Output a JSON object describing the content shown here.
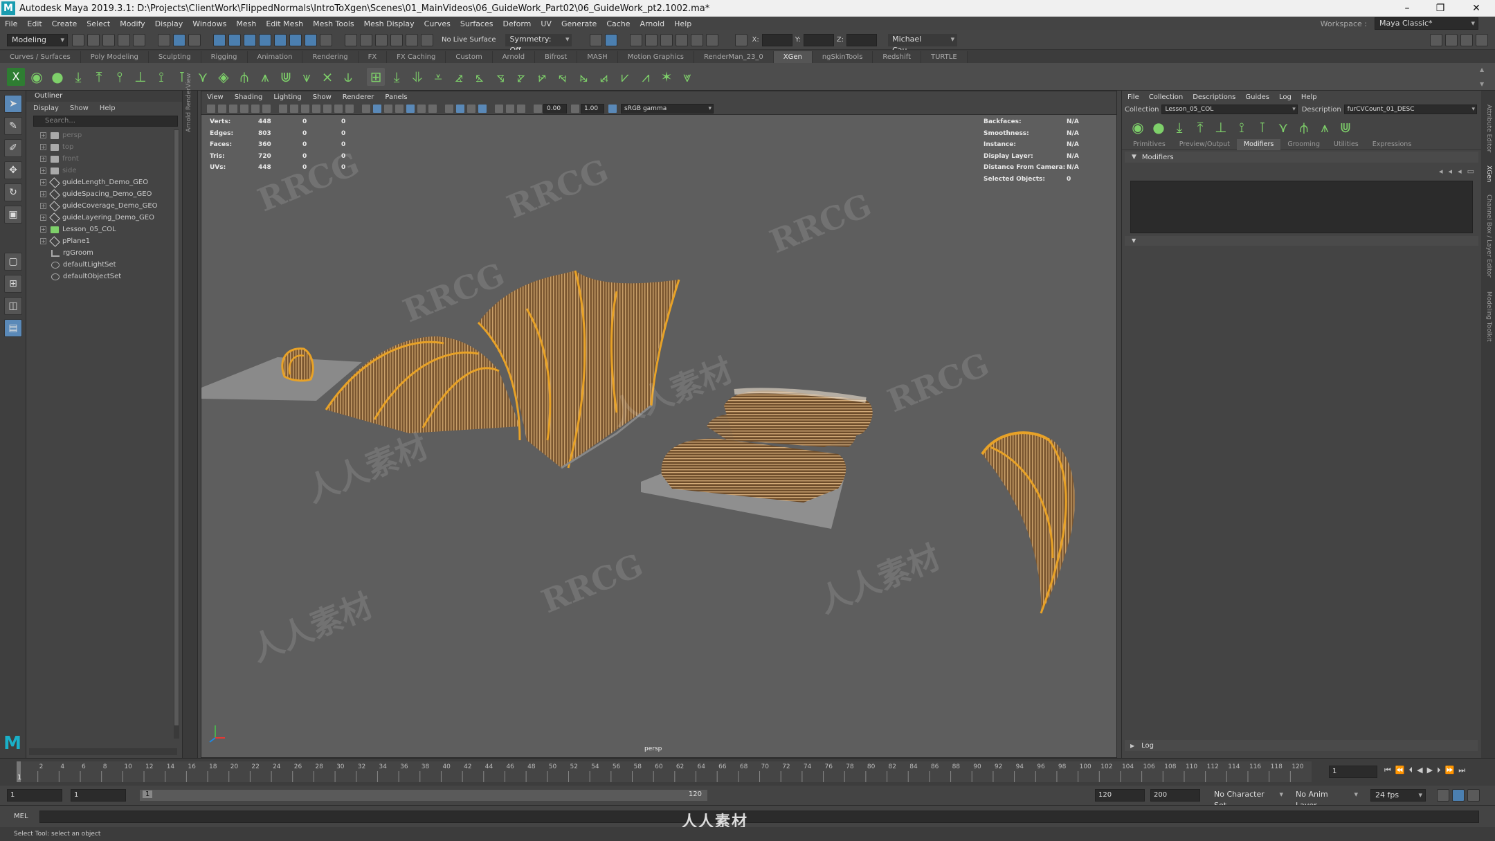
{
  "window": {
    "title": "Autodesk Maya 2019.3.1: D:\\Projects\\ClientWork\\FlippedNormals\\IntroToXgen\\Scenes\\01_MainVideos\\06_GuideWork_Part02\\06_GuideWork_pt2.1002.ma*",
    "minimize": "–",
    "restore": "❐",
    "close": "✕"
  },
  "menubar": [
    "File",
    "Edit",
    "Create",
    "Select",
    "Modify",
    "Display",
    "Windows",
    "Mesh",
    "Edit Mesh",
    "Mesh Tools",
    "Mesh Display",
    "Curves",
    "Surfaces",
    "Deform",
    "UV",
    "Generate",
    "Cache",
    "Arnold",
    "Help"
  ],
  "workspace": {
    "label": "Workspace :",
    "value": "Maya Classic*"
  },
  "status": {
    "mode": "Modeling",
    "live_surface": "No Live Surface",
    "symmetry": "Symmetry: Off",
    "user": "Michael Cau...",
    "x": "X:",
    "y": "Y:",
    "z": "Z:"
  },
  "shelf_tabs": [
    "Curves / Surfaces",
    "Poly Modeling",
    "Sculpting",
    "Rigging",
    "Animation",
    "Rendering",
    "FX",
    "FX Caching",
    "Custom",
    "Arnold",
    "Bifrost",
    "MASH",
    "Motion Graphics",
    "RenderMan_23_0",
    "XGen",
    "ngSkinTools",
    "Redshift",
    "TURTLE"
  ],
  "active_shelf": "XGen",
  "outliner": {
    "title": "Outliner",
    "menu": [
      "Display",
      "Show",
      "Help"
    ],
    "search_placeholder": "Search...",
    "items": [
      {
        "label": "persp",
        "type": "cam",
        "dim": true
      },
      {
        "label": "top",
        "type": "cam",
        "dim": true
      },
      {
        "label": "front",
        "type": "cam",
        "dim": true
      },
      {
        "label": "side",
        "type": "cam",
        "dim": true
      },
      {
        "label": "guideLength_Demo_GEO",
        "type": "mesh",
        "dim": false
      },
      {
        "label": "guideSpacing_Demo_GEO",
        "type": "mesh",
        "dim": false
      },
      {
        "label": "guideCoverage_Demo_GEO",
        "type": "mesh",
        "dim": false
      },
      {
        "label": "guideLayering_Demo_GEO",
        "type": "mesh",
        "dim": false
      },
      {
        "label": "Lesson_05_COL",
        "type": "coll",
        "dim": false
      },
      {
        "label": "pPlane1",
        "type": "mesh",
        "dim": false
      },
      {
        "label": "rgGroom",
        "type": "groom",
        "dim": false
      },
      {
        "label": "defaultLightSet",
        "type": "set",
        "dim": false
      },
      {
        "label": "defaultObjectSet",
        "type": "set",
        "dim": false
      }
    ]
  },
  "side_strip_label": "Arnold RenderView",
  "viewport": {
    "menu": [
      "View",
      "Shading",
      "Lighting",
      "Show",
      "Renderer",
      "Panels"
    ],
    "exposure": "0.00",
    "gamma": "1.00",
    "colorspace": "sRGB gamma",
    "camera_label": "persp",
    "hud_left": [
      {
        "k": "Verts:",
        "a": "448",
        "b": "0",
        "c": "0"
      },
      {
        "k": "Edges:",
        "a": "803",
        "b": "0",
        "c": "0"
      },
      {
        "k": "Faces:",
        "a": "360",
        "b": "0",
        "c": "0"
      },
      {
        "k": "Tris:",
        "a": "720",
        "b": "0",
        "c": "0"
      },
      {
        "k": "UVs:",
        "a": "448",
        "b": "0",
        "c": "0"
      }
    ],
    "hud_right": [
      {
        "k": "Backfaces:",
        "v": "N/A"
      },
      {
        "k": "Smoothness:",
        "v": "N/A"
      },
      {
        "k": "Instance:",
        "v": "N/A"
      },
      {
        "k": "Display Layer:",
        "v": "N/A"
      },
      {
        "k": "Distance From Camera:",
        "v": "N/A"
      },
      {
        "k": "Selected Objects:",
        "v": "0"
      }
    ]
  },
  "xgen": {
    "menu": [
      "File",
      "Collection",
      "Descriptions",
      "Guides",
      "Log",
      "Help"
    ],
    "collection_label": "Collection",
    "collection_value": "Lesson_05_COL",
    "description_label": "Description",
    "description_value": "furCVCount_01_DESC",
    "tabs": [
      "Primitives",
      "Preview/Output",
      "Modifiers",
      "Grooming",
      "Utilities",
      "Expressions"
    ],
    "active_tab": "Modifiers",
    "section": "Modifiers",
    "log_label": "Log"
  },
  "right_strip": [
    "Attribute Editor",
    "XGen",
    "Channel Box / Layer Editor",
    "Modeling Toolkit"
  ],
  "timeline": {
    "ticks": [
      "2",
      "4",
      "6",
      "8",
      "10",
      "12",
      "14",
      "16",
      "18",
      "20",
      "22",
      "24",
      "26",
      "28",
      "30",
      "32",
      "34",
      "36",
      "38",
      "40",
      "42",
      "44",
      "46",
      "48",
      "50",
      "52",
      "54",
      "56",
      "58",
      "60",
      "62",
      "64",
      "66",
      "68",
      "70",
      "72",
      "74",
      "76",
      "78",
      "80",
      "82",
      "84",
      "86",
      "88",
      "90",
      "92",
      "94",
      "96",
      "98",
      "100",
      "102",
      "104",
      "106",
      "108",
      "110",
      "112",
      "114",
      "116",
      "118",
      "120"
    ],
    "current_frame": "1",
    "current_field": "1"
  },
  "range": {
    "start": "1",
    "start2": "1",
    "range_start_label": "1",
    "range_end_label": "120",
    "end": "120",
    "end2": "200",
    "char_set": "No Character Set",
    "anim_layer": "No Anim Layer",
    "fps": "24 fps"
  },
  "mel": {
    "label": "MEL"
  },
  "help_line": "Select Tool: select an object",
  "watermarks": [
    "RRCG",
    "人人素材"
  ],
  "bottom_brand": "人人素材",
  "colors": {
    "accent": "#5a89b8",
    "hair": "#e8a227",
    "xgen_green": "#7ed06a"
  }
}
